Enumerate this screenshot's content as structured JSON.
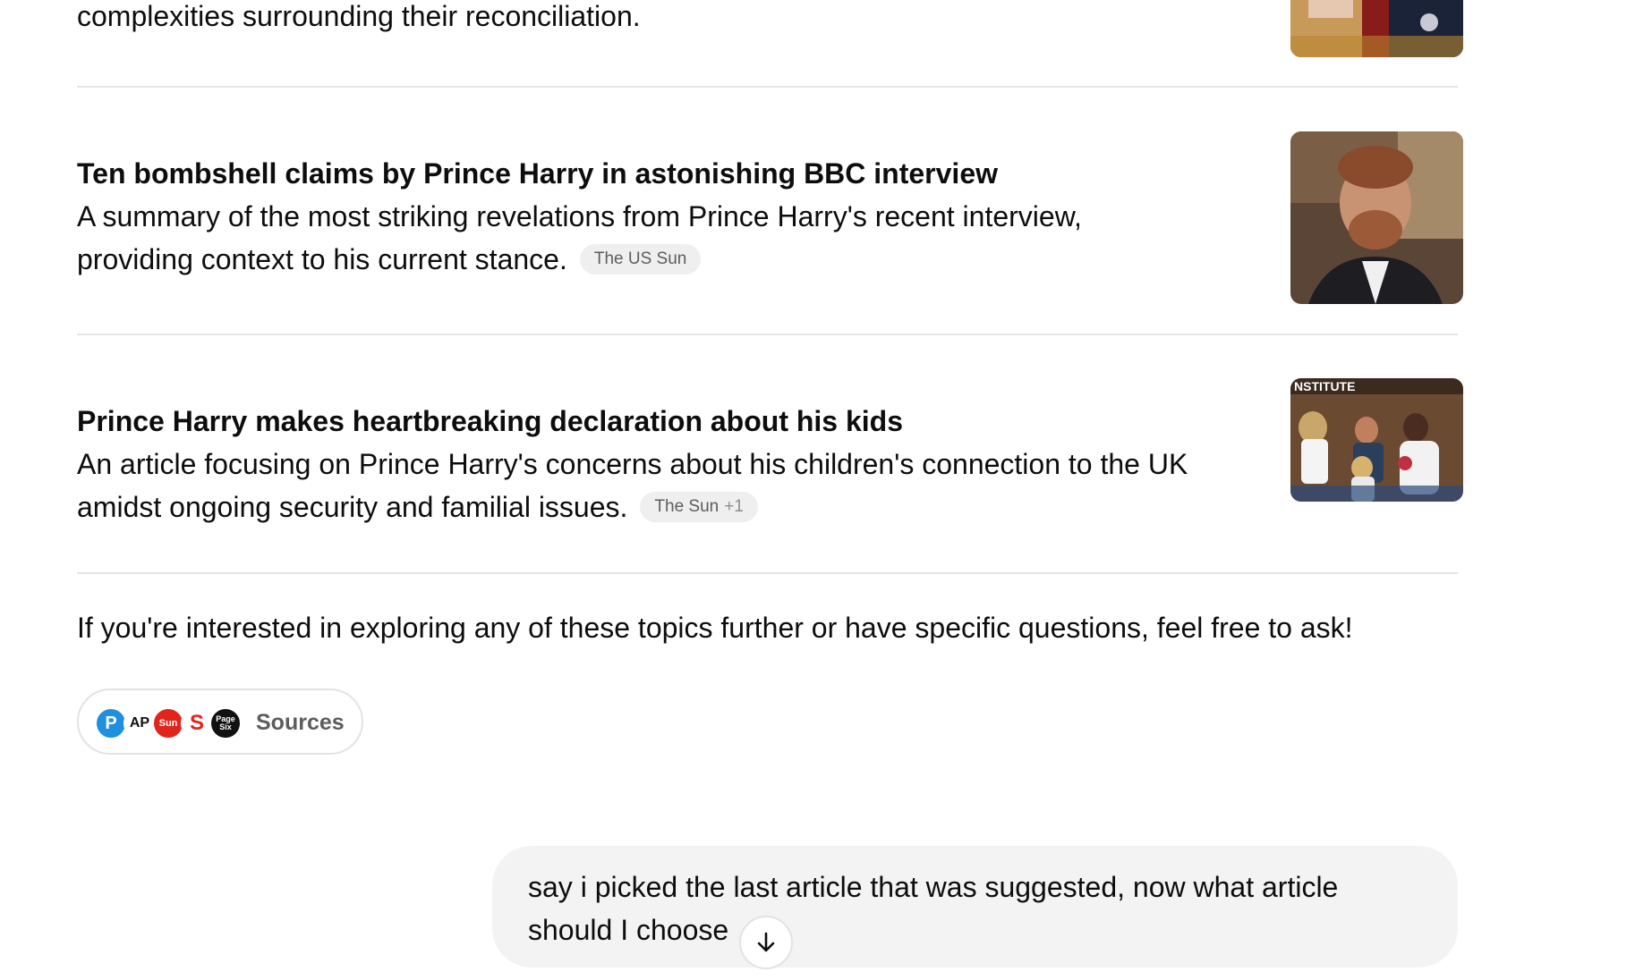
{
  "intro_tail": "complexities surrounding their reconciliation.",
  "articles": [
    {
      "title": "Ten bombshell claims by Prince Harry in astonishing BBC interview",
      "summary_line1": "A summary of the most striking revelations from Prince Harry's recent interview,",
      "summary_line2": "providing context to his current stance.",
      "source": "The US Sun",
      "source_extra": ""
    },
    {
      "title": "Prince Harry makes heartbreaking declaration about his kids",
      "summary_line1": "An article focusing on Prince Harry's concerns about his children's connection to the UK",
      "summary_line2": "amidst ongoing security and familial issues.",
      "source": "The Sun",
      "source_extra": "+1"
    }
  ],
  "closing_text": "If you're interested in exploring any of these topics further or have specific questions, feel free to ask!",
  "sources": {
    "label": "Sources",
    "icons": [
      {
        "name": "p-source-icon",
        "glyph": "P"
      },
      {
        "name": "ap-source-icon",
        "glyph": "AP"
      },
      {
        "name": "the-sun-source-icon",
        "glyph": "Sun"
      },
      {
        "name": "s-source-icon",
        "glyph": "S"
      },
      {
        "name": "page-six-source-icon",
        "glyph": "Page Six"
      }
    ]
  },
  "user_message": {
    "line1": "say i picked the last article that was suggested, now what article",
    "line2": "should I choose"
  },
  "colors": {
    "divider": "#e5e5e5",
    "badge_bg": "#efefef",
    "bubble_bg": "#f3f3f3",
    "sun_red": "#e1251b",
    "p_blue": "#1f8fe0"
  }
}
